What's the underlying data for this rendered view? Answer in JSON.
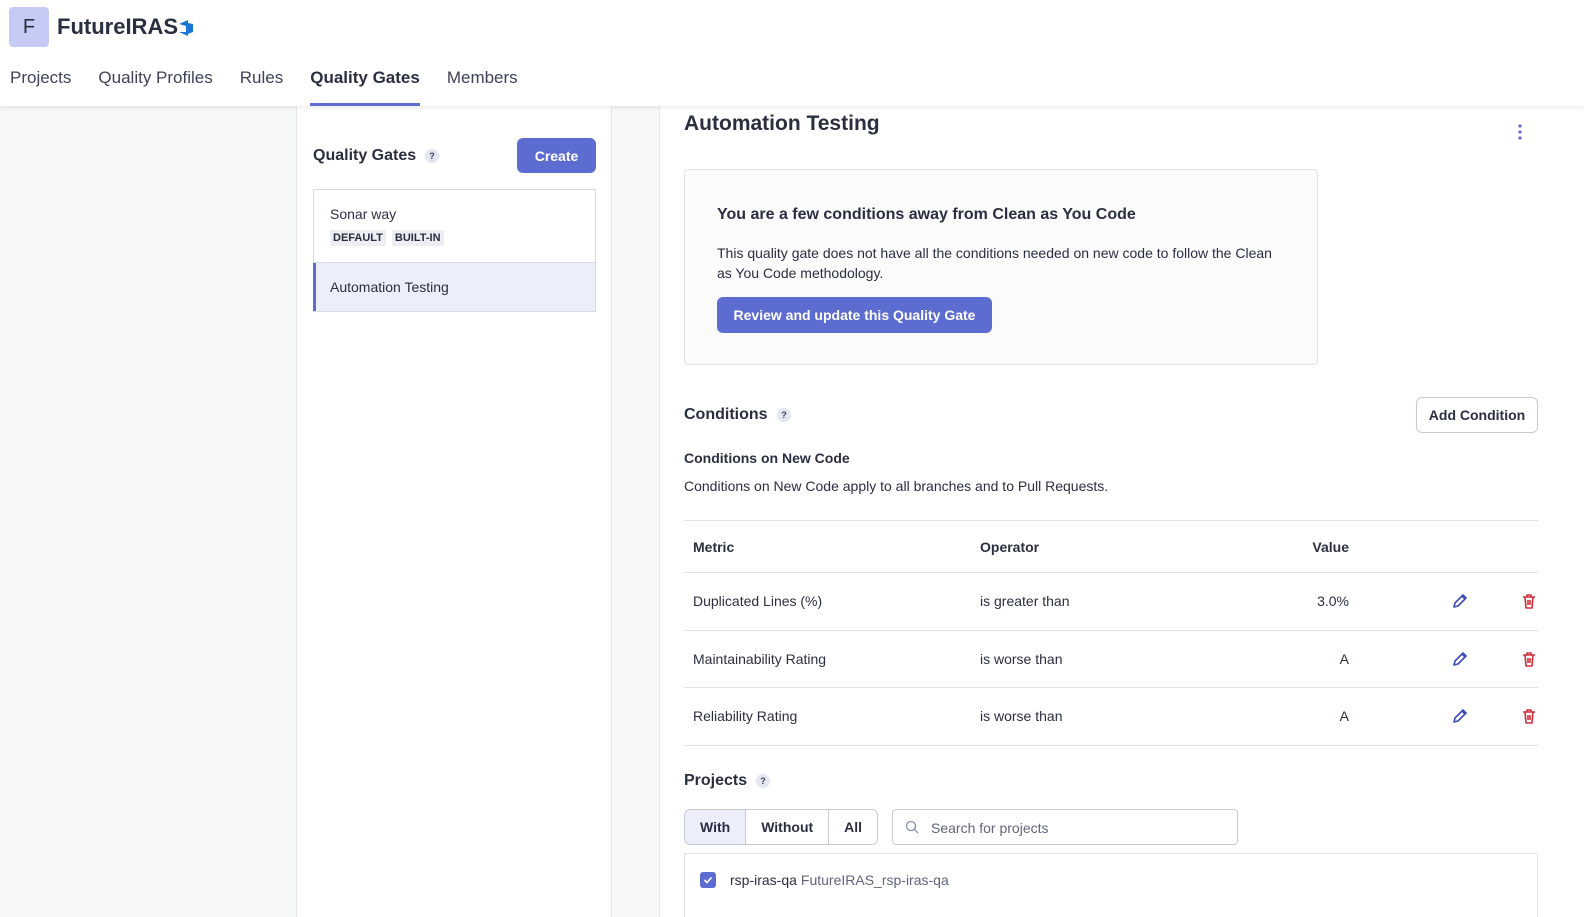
{
  "header": {
    "org_initial": "F",
    "org_name": "FutureIRAS",
    "nav": [
      "Projects",
      "Quality Profiles",
      "Rules",
      "Quality Gates",
      "Members"
    ],
    "active_nav": "Quality Gates"
  },
  "sidebar": {
    "title": "Quality Gates",
    "help": "?",
    "create_label": "Create",
    "gates": [
      {
        "name": "Sonar way",
        "tags": [
          "DEFAULT",
          "BUILT-IN"
        ]
      },
      {
        "name": "Automation Testing",
        "tags": []
      }
    ],
    "selected_gate": "Automation Testing"
  },
  "main": {
    "title": "Automation Testing",
    "cayc": {
      "title": "You are a few conditions away from Clean as You Code",
      "text": "This quality gate does not have all the conditions needed on new code to follow the Clean as You Code methodology.",
      "button": "Review and update this Quality Gate"
    },
    "conditions": {
      "title": "Conditions",
      "help": "?",
      "add_label": "Add Condition",
      "new_code_title": "Conditions on New Code",
      "new_code_desc": "Conditions on New Code apply to all branches and to Pull Requests.",
      "headers": {
        "metric": "Metric",
        "operator": "Operator",
        "value": "Value"
      },
      "rows": [
        {
          "metric": "Duplicated Lines (%)",
          "operator": "is greater than",
          "value": "3.0%"
        },
        {
          "metric": "Maintainability Rating",
          "operator": "is worse than",
          "value": "A"
        },
        {
          "metric": "Reliability Rating",
          "operator": "is worse than",
          "value": "A"
        }
      ]
    },
    "projects": {
      "title": "Projects",
      "help": "?",
      "filters": [
        "With",
        "Without",
        "All"
      ],
      "active_filter": "With",
      "search_placeholder": "Search for projects",
      "items": [
        {
          "name": "rsp-iras-qa",
          "key": "FutureIRAS_rsp-iras-qa",
          "checked": true
        }
      ]
    }
  },
  "colors": {
    "accent": "#5d6cd0",
    "danger": "#d02f3a",
    "avatar_bg": "#c5cbf5"
  }
}
